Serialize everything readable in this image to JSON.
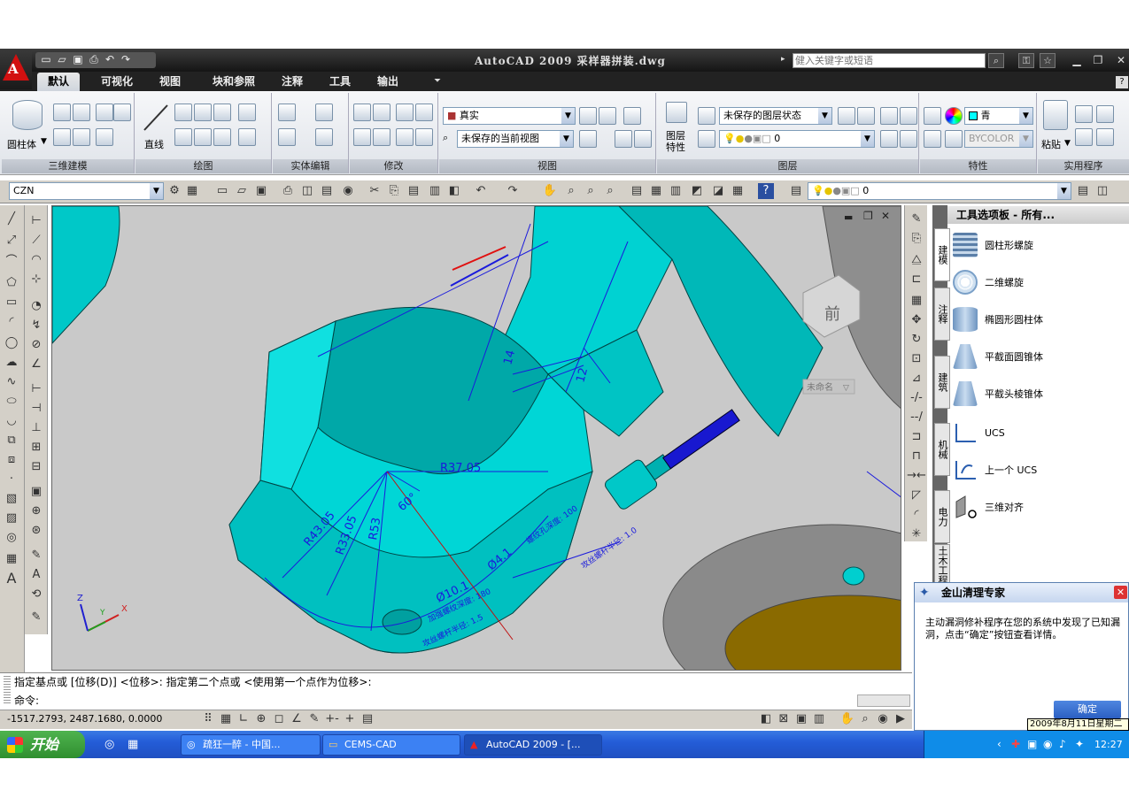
{
  "titlebar": {
    "app_title": "AutoCAD 2009 采样器拼装.dwg",
    "search_placeholder": "健入关键字或短语",
    "app_letter": "A"
  },
  "ribbon": {
    "tabs": [
      {
        "label": "默认",
        "active": true
      },
      {
        "label": "可视化"
      },
      {
        "label": "视图"
      },
      {
        "label": "块和参照"
      },
      {
        "label": "注释"
      },
      {
        "label": "工具"
      },
      {
        "label": "输出"
      }
    ],
    "panels": {
      "modeling": {
        "title": "三维建模",
        "cylinder_label": "圆柱体"
      },
      "draw": {
        "title": "绘图",
        "line_label": "直线"
      },
      "solid_edit": {
        "title": "实体编辑"
      },
      "modify": {
        "title": "修改"
      },
      "view": {
        "title": "视图",
        "visual_style": "真实",
        "saved_view": "未保存的当前视图"
      },
      "layers": {
        "title": "图层",
        "layer_state": "未保存的图层状态",
        "current_layer": "0",
        "layer_props_label": "图层特性"
      },
      "properties": {
        "title": "特性",
        "color": "青",
        "linetype": "BYCOLOR"
      },
      "utilities": {
        "title": "实用程序",
        "paste_label": "粘贴"
      }
    }
  },
  "toolbar2": {
    "ucs_name": "CZN",
    "layer_combo": "0"
  },
  "viewport": {
    "cube_face": "前",
    "ucs_name_label": "未命名",
    "dims": {
      "r37": "R37.05",
      "r43": "R43.05",
      "r33": "R33.05",
      "r53": "R53",
      "ang": "60°",
      "d41": "Ø4.1",
      "d101": "Ø10.1",
      "d14": "14",
      "d12": "12",
      "note1": "螺纹孔深度: 100",
      "note2": "加强螺纹深度: 180",
      "note3": "攻丝螺杆半径: 1.5",
      "note4": "攻丝螺杆半径: 1.0"
    }
  },
  "palette": {
    "title": "工具选项板 - 所有...",
    "tabs": [
      "建模",
      "注释",
      "建筑",
      "机械",
      "电力",
      "土木工程"
    ],
    "items": [
      {
        "label": "圆柱形螺旋"
      },
      {
        "label": "二维螺旋"
      },
      {
        "label": "椭圆形圆柱体"
      },
      {
        "label": "平截面圆锥体"
      },
      {
        "label": "平截头棱锥体"
      },
      {
        "label": "UCS"
      },
      {
        "label": "上一个 UCS"
      },
      {
        "label": "三维对齐"
      }
    ]
  },
  "command": {
    "history": "指定基点或 [位移(D)] <位移>:  指定第二个点或 <使用第一个点作为位移>:",
    "prompt": "命令:"
  },
  "status": {
    "coords": "-1517.2793, 2487.1680, 0.0000"
  },
  "popup": {
    "title": "金山清理专家",
    "message": "主动漏洞修补程序在您的系统中发现了已知漏洞，点击“确定”按钮查看详情。",
    "ok_label": "确定",
    "date_tip": "2009年8月11日星期二"
  },
  "taskbar": {
    "start_label": "开始",
    "tasks": [
      {
        "label": "疏狂一醉 - 中国..."
      },
      {
        "label": "CEMS-CAD"
      },
      {
        "label": "AutoCAD 2009 - [..."
      }
    ],
    "clock": "12:27"
  }
}
